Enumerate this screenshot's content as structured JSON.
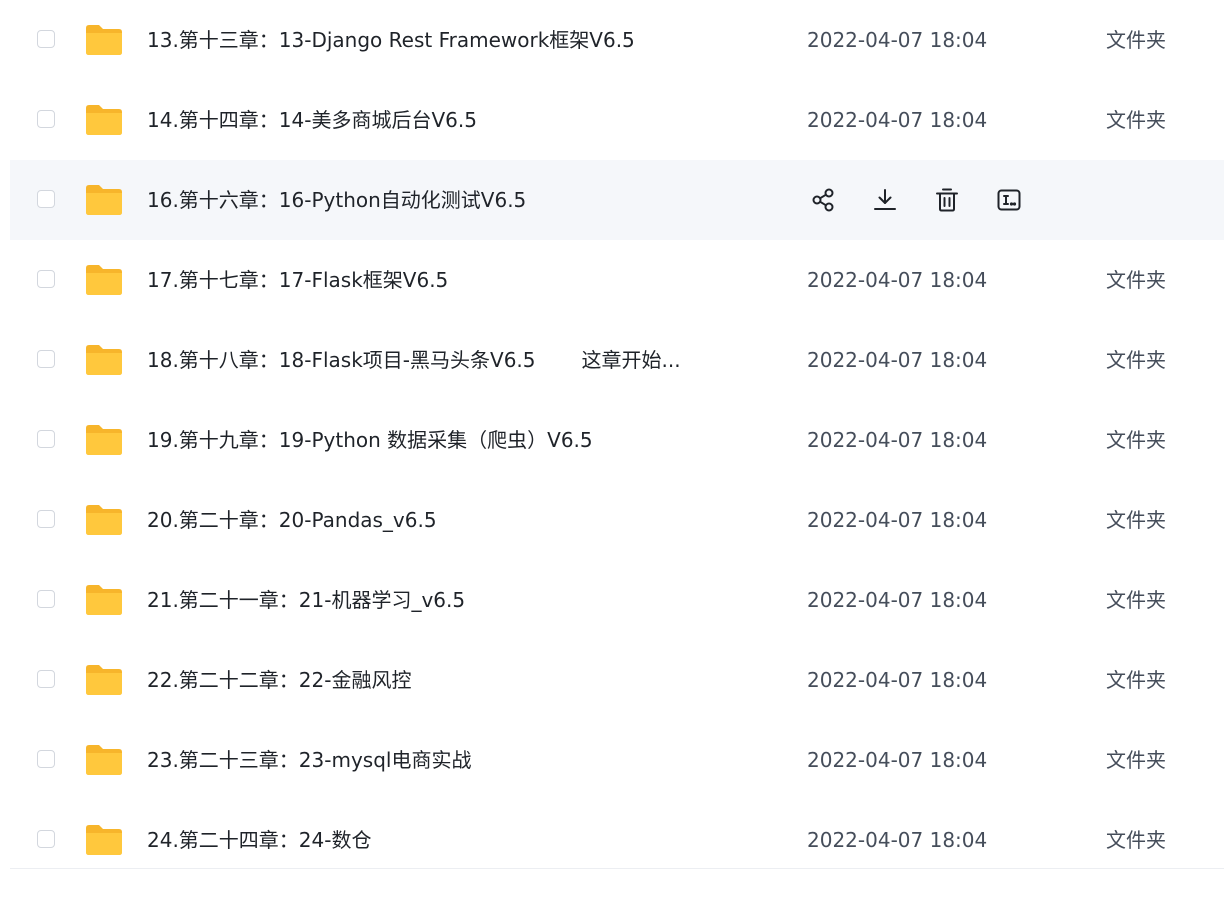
{
  "rows": [
    {
      "name": "13.第十三章：13-Django Rest Framework框架V6.5",
      "tail": "",
      "date": "2022-04-07 18:04",
      "type": "文件夹",
      "hover": false
    },
    {
      "name": "14.第十四章：14-美多商城后台V6.5",
      "tail": "",
      "date": "2022-04-07 18:04",
      "type": "文件夹",
      "hover": false
    },
    {
      "name": "16.第十六章：16-Python自动化测试V6.5",
      "tail": "",
      "date": "",
      "type": "",
      "hover": true
    },
    {
      "name": "17.第十七章：17-Flask框架V6.5",
      "tail": "",
      "date": "2022-04-07 18:04",
      "type": "文件夹",
      "hover": false
    },
    {
      "name": "18.第十八章：18-Flask项目-黑马头条V6.5",
      "tail": "这章开始...",
      "date": "2022-04-07 18:04",
      "type": "文件夹",
      "hover": false
    },
    {
      "name": "19.第十九章：19-Python 数据采集（爬虫）V6.5",
      "tail": "",
      "date": "2022-04-07 18:04",
      "type": "文件夹",
      "hover": false
    },
    {
      "name": "20.第二十章：20-Pandas_v6.5",
      "tail": "",
      "date": "2022-04-07 18:04",
      "type": "文件夹",
      "hover": false
    },
    {
      "name": "21.第二十一章：21-机器学习_v6.5",
      "tail": "",
      "date": "2022-04-07 18:04",
      "type": "文件夹",
      "hover": false
    },
    {
      "name": "22.第二十二章：22-金融风控",
      "tail": "",
      "date": "2022-04-07 18:04",
      "type": "文件夹",
      "hover": false
    },
    {
      "name": "23.第二十三章：23-mysql电商实战",
      "tail": "",
      "date": "2022-04-07 18:04",
      "type": "文件夹",
      "hover": false
    },
    {
      "name": "24.第二十四章：24-数仓",
      "tail": "",
      "date": "2022-04-07 18:04",
      "type": "文件夹",
      "hover": false
    }
  ],
  "icons": {
    "folder": "folder-icon",
    "actions": [
      "share-icon",
      "download-icon",
      "delete-icon",
      "rename-icon"
    ]
  },
  "colors": {
    "folder": "#ffc83d",
    "folder_tab": "#f7b52b",
    "hover_bg": "#f5f7fa",
    "text": "#1f2329",
    "muted": "#454d5a"
  }
}
